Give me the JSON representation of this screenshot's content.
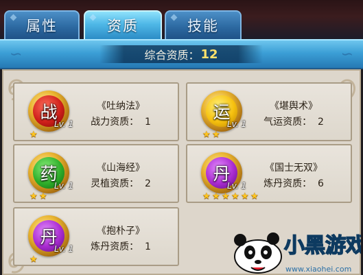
{
  "tabs": [
    {
      "label": "属性",
      "active": false
    },
    {
      "label": "资质",
      "active": true
    },
    {
      "label": "技能",
      "active": false
    }
  ],
  "summary": {
    "label": "综合资质：",
    "value": "12"
  },
  "cards": [
    {
      "glyph": "战",
      "color": "red",
      "level": "Lv. 1",
      "name": "《吐纳法》",
      "quality": "战力资质：  1",
      "stars": 1
    },
    {
      "glyph": "运",
      "color": "yellow",
      "level": "Lv. 1",
      "name": "《堪舆术》",
      "quality": "气运资质：  2",
      "stars": 2
    },
    {
      "glyph": "药",
      "color": "green",
      "level": "Lv. 1",
      "name": "《山海经》",
      "quality": "灵植资质：  2",
      "stars": 2
    },
    {
      "glyph": "丹",
      "color": "purple",
      "level": "Lv. 1",
      "name": "《国士无双》",
      "quality": "炼丹资质：  6",
      "stars": 6
    },
    {
      "glyph": "丹",
      "color": "purple",
      "level": "Lv. 1",
      "name": "《抱朴子》",
      "quality": "炼丹资质：  1",
      "stars": 1
    }
  ],
  "watermark": {
    "text": "小黑游戏",
    "url": "www.xiaohei.com"
  }
}
